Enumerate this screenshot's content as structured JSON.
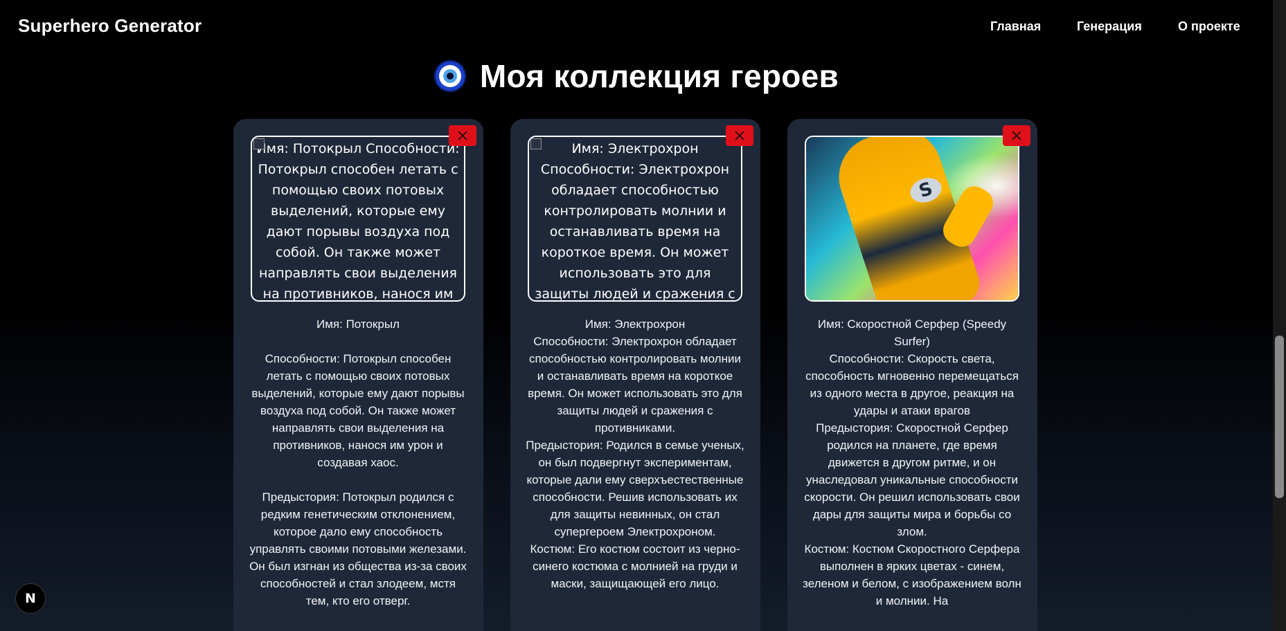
{
  "navbar": {
    "brand": "Superhero Generator",
    "links": [
      "Главная",
      "Генерация",
      "О проекте"
    ]
  },
  "page": {
    "title": "Моя коллекция героев",
    "title_icon": "nazar-eye-icon"
  },
  "cards": [
    {
      "image_alt": "Имя: Потокрыл Способности: Потокрыл способен летать с помощью своих потовых выделений, которые ему дают порывы воздуха под собой. Он также может направлять свои выделения на противников, нанося им урон и создавая хаос.",
      "description": "Имя: Потокрыл\n\nСпособности: Потокрыл способен летать с помощью своих потовых выделений, которые ему дают порывы воздуха под собой. Он также может направлять свои выделения на противников, нанося им урон и создавая хаос.\n\nПредыстория: Потокрыл родился с редким генетическим отклонением, которое дало ему способность управлять своими потовыми железами. Он был изгнан из общества из-за своих способностей и стал злодеем, мстя тем, кто его отверг."
    },
    {
      "image_alt": "Имя: Электрохрон Способности: Электрохрон обладает способностью контролировать молнии и останавливать время на короткое время. Он может использовать это для защиты людей и сражения с",
      "description": "Имя: Электрохрон\nСпособности: Электрохрон обладает способностью контролировать молнии и останавливать время на короткое время. Он может использовать это для защиты людей и сражения с противниками.\nПредыстория: Родился в семье ученых, он был подвергнут экспериментам, которые дали ему сверхъестественные способности. Решив использовать их для защиты невинных, он стал супергероем Электрохроном.\nКостюм: Его костюм состоит из черно-синего костюма с молнией на груди и маски, защищающей его лицо."
    },
    {
      "image_alt": "",
      "description": "Имя: Скоростной Серфер (Speedy Surfer)\nСпособности: Скорость света, способность мгновенно перемещаться из одного места в другое, реакция на удары и атаки врагов\nПредыстория: Скоростной Серфер родился на планете, где время движется в другом ритме, и он унаследовал уникальные способности скорости. Он решил использовать свои дары для защиты мира и борьбы со злом.\nКостюм: Костюм Скоростного Серфера выполнен в ярких цветах - синем, зеленом и белом, с изображением волн и молнии. На"
    }
  ],
  "delete_icon": "close-icon",
  "hero_emblem": "S",
  "dev_badge": "N",
  "colors": {
    "card_bg": "#1f2838",
    "delete_btn": "#e0101a",
    "page_bg_top": "#000000"
  }
}
